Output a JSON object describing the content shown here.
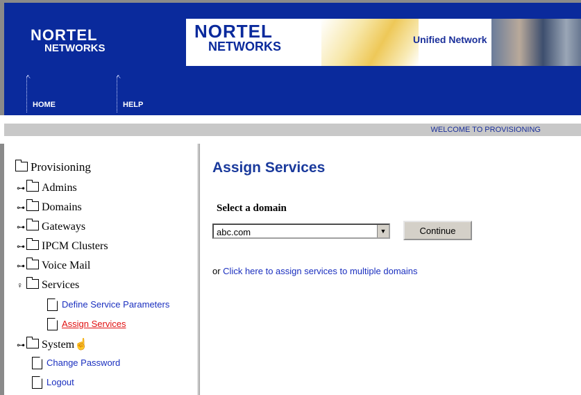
{
  "header": {
    "logo_line1": "NORTEL",
    "logo_line2": "NETWORKS",
    "banner_logo_line1": "NORTEL",
    "banner_logo_line2": "NETWORKS",
    "banner_tagline": "Unified Network",
    "nav": [
      {
        "label": "HOME"
      },
      {
        "label": "HELP"
      }
    ],
    "welcome": "WELCOME TO PROVISIONING",
    "bg_color": "#0a2a9c"
  },
  "sidebar": {
    "root": "Provisioning",
    "nodes": [
      {
        "label": "Admins",
        "expanded": false
      },
      {
        "label": "Domains",
        "expanded": false
      },
      {
        "label": "Gateways",
        "expanded": false
      },
      {
        "label": "IPCM Clusters",
        "expanded": false
      },
      {
        "label": "Voice Mail",
        "expanded": false
      },
      {
        "label": "Services",
        "expanded": true
      },
      {
        "label": "System",
        "expanded": false
      }
    ],
    "services_children": [
      {
        "label": "Define Service Parameters"
      },
      {
        "label": "Assign Services"
      }
    ],
    "bottom_links": [
      {
        "label": "Change Password"
      },
      {
        "label": "Logout"
      }
    ]
  },
  "main": {
    "title": "Assign Services",
    "select_label": "Select a domain",
    "domain_value": "abc.com",
    "continue_label": "Continue",
    "or_text": "or ",
    "multi_link": "Click here to assign services to multiple domains"
  }
}
